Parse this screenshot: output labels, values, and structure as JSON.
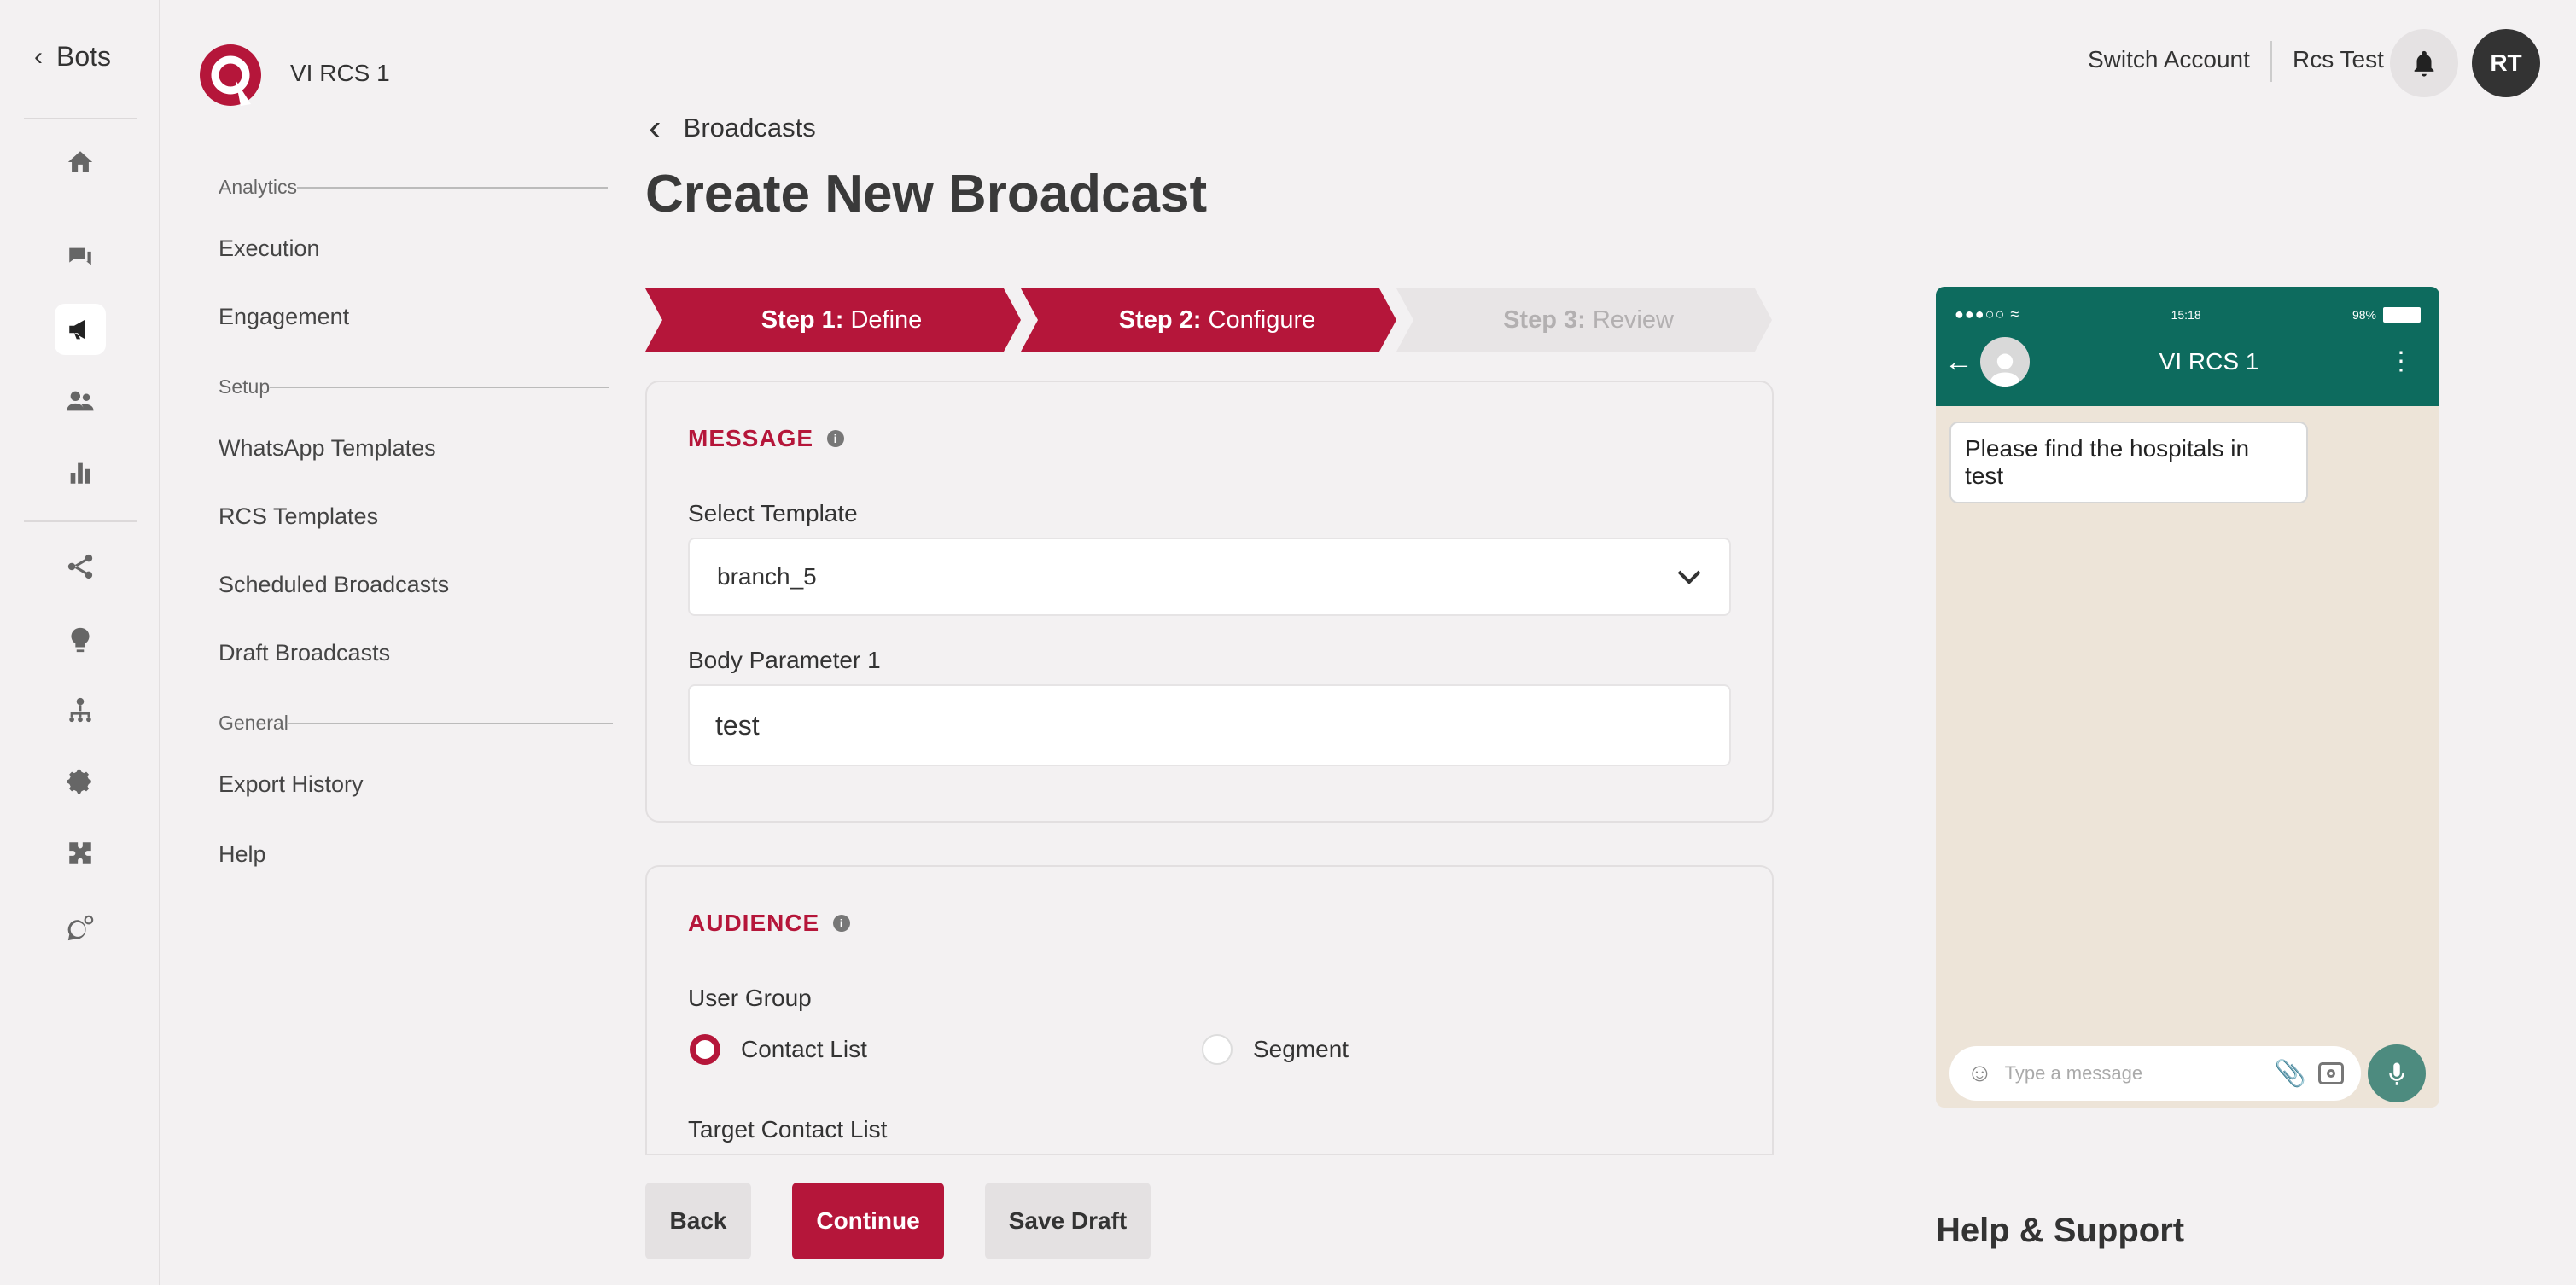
{
  "rail": {
    "back_label": "Bots",
    "icons": [
      "home-icon",
      "chat-icon",
      "broadcast-icon",
      "users-icon",
      "bar-chart-icon",
      "flow-icon",
      "bulb-icon",
      "hierarchy-icon",
      "gear-icon",
      "puzzle-icon",
      "whatsapp-settings-icon"
    ]
  },
  "sidebar": {
    "bot_name": "VI RCS 1",
    "sections": [
      {
        "label": "Analytics",
        "items": [
          "Execution",
          "Engagement"
        ]
      },
      {
        "label": "Setup",
        "items": [
          "WhatsApp Templates",
          "RCS Templates",
          "Scheduled Broadcasts",
          "Draft Broadcasts"
        ]
      },
      {
        "label": "General",
        "items": [
          "Export History",
          "Help"
        ]
      }
    ]
  },
  "header": {
    "switch_account": "Switch Account",
    "user_name": "Rcs Test",
    "avatar_initials": "RT"
  },
  "main": {
    "breadcrumb": "Broadcasts",
    "title": "Create New Broadcast",
    "steps": [
      {
        "num": "Step 1:",
        "name": "Define",
        "state": "complete"
      },
      {
        "num": "Step 2:",
        "name": "Configure",
        "state": "active"
      },
      {
        "num": "Step 3:",
        "name": "Review",
        "state": "pending"
      }
    ],
    "message": {
      "title": "MESSAGE",
      "select_label": "Select Template",
      "select_value": "branch_5",
      "param_label": "Body Parameter 1",
      "param_value": "test"
    },
    "audience": {
      "title": "AUDIENCE",
      "group_label": "User Group",
      "options": [
        "Contact List",
        "Segment"
      ],
      "selected": "Contact List",
      "target_label": "Target Contact List"
    },
    "buttons": {
      "back": "Back",
      "continue": "Continue",
      "save_draft": "Save Draft"
    }
  },
  "preview": {
    "time": "15:18",
    "battery": "98%",
    "contact_name": "VI RCS 1",
    "message": "Please find the hospitals in test",
    "input_placeholder": "Type a message"
  },
  "help_title": "Help & Support",
  "colors": {
    "brand": "#b5163a",
    "whatsapp_header": "#0d6b5e",
    "chat_bg": "#ede4d8"
  }
}
